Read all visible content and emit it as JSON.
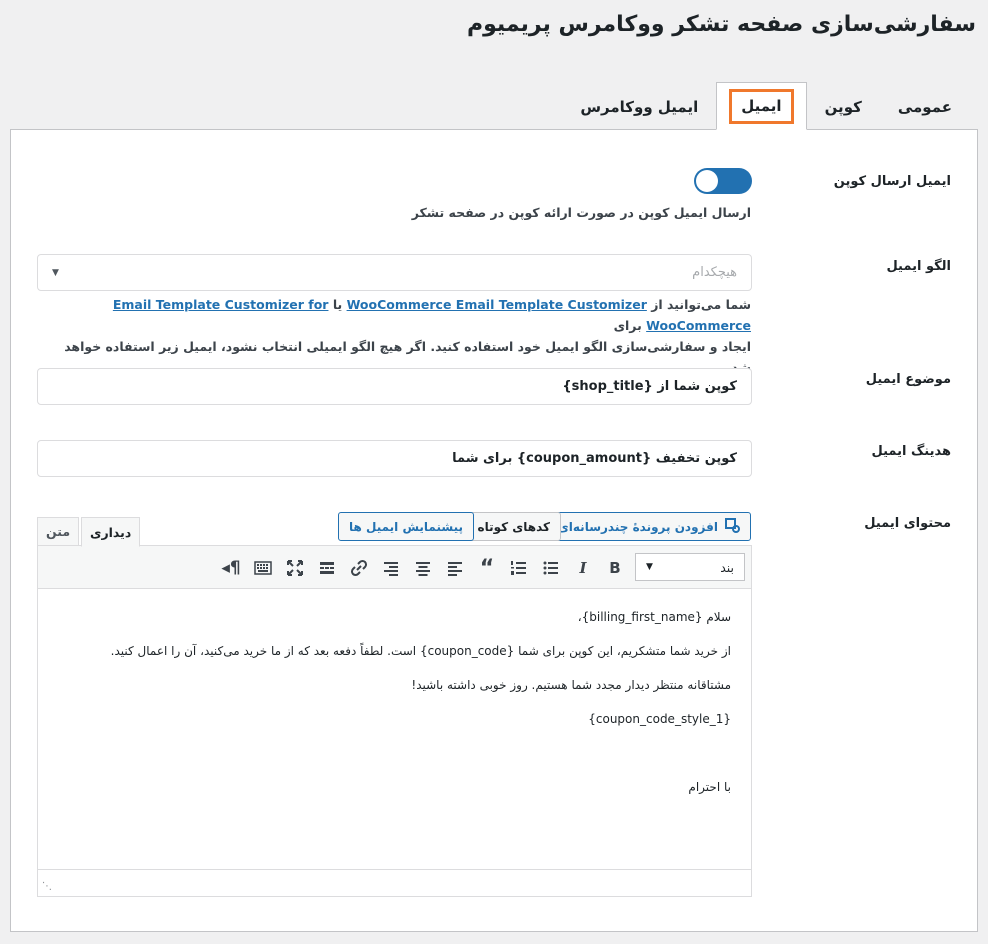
{
  "page": {
    "title": "سفارشی‌سازی صفحه تشکر ووکامرس پریمیوم"
  },
  "tabs": [
    {
      "label": "عمومی"
    },
    {
      "label": "کوپن"
    },
    {
      "label": "ایمیل"
    },
    {
      "label": "ایمیل ووکامرس"
    }
  ],
  "active_tab": "ایمیل",
  "fields": {
    "coupon_email": {
      "label": "ایمیل ارسال کوپن",
      "enabled": true,
      "description": "ارسال ایمیل کوپن در صورت ارائه کوپن در صفحه تشکر"
    },
    "email_template": {
      "label": "الگو ایمیل",
      "value": "هیچکدام",
      "desc_prefix": "شما می‌توانید از",
      "link1": "WooCommerce Email Template Customizer",
      "desc_or": "یا",
      "link2": "Email Template Customizer for WooCommerce",
      "desc_mid": "برای",
      "desc_line2": "ایجاد و سفارشی‌سازی الگو ایمیل خود استفاده کنید. اگر هیچ الگو ایمیلی انتخاب نشود، ایمیل زیر استفاده خواهد شد."
    },
    "email_subject": {
      "label": "موضوع ایمیل",
      "value": "کوپن شما از {shop_title}"
    },
    "email_heading": {
      "label": "هدینگ ایمیل",
      "value": "کوپن تخفیف {coupon_amount} برای شما"
    },
    "email_content": {
      "label": "محتوای ایمیل",
      "buttons": {
        "add_media": "افزودن پروندهٔ چندرسانه‌ای",
        "shortcodes": "کدهای کوتاه",
        "preview": "پیشنمایش ایمیل ها"
      },
      "editor_tabs": {
        "visual": "دیداری",
        "text": "متن"
      },
      "format_select": "بند",
      "paragraphs": [
        "سلام {billing_first_name}،",
        "از خرید شما متشکریم، این کوپن برای شما {coupon_code} است. لطفاً دفعه بعد که از ما خرید می‌کنید، آن را اعمال کنید.",
        "مشتاقانه منتظر دیدار مجدد شما هستیم. روز خوبی داشته باشید!",
        "{coupon_code_style_1}",
        "",
        "با احترام"
      ]
    }
  },
  "colors": {
    "accent": "#2271b1",
    "highlight": "#f0782c"
  }
}
